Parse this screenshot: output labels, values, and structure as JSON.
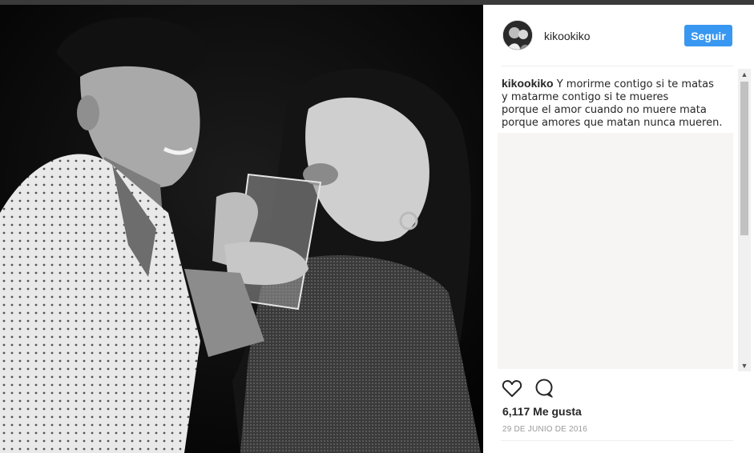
{
  "post": {
    "username": "kikookiko",
    "follow_label": "Seguir",
    "caption_user": "kikookiko",
    "caption_lines": [
      "Y morirme contigo si te matas",
      "y matarme contigo si te mueres",
      "porque el amor cuando no muere mata",
      "porque amores que matan nunca mueren."
    ],
    "likes": "6,117 Me gusta",
    "date": "29 DE JUNIO DE 2016"
  },
  "icons": {
    "like": "heart-icon",
    "comment": "comment-icon",
    "scroll_up": "scroll-up-arrow",
    "scroll_down": "scroll-down-arrow"
  },
  "colors": {
    "follow_button": "#3897f0",
    "text": "#262626",
    "muted": "#999999"
  }
}
